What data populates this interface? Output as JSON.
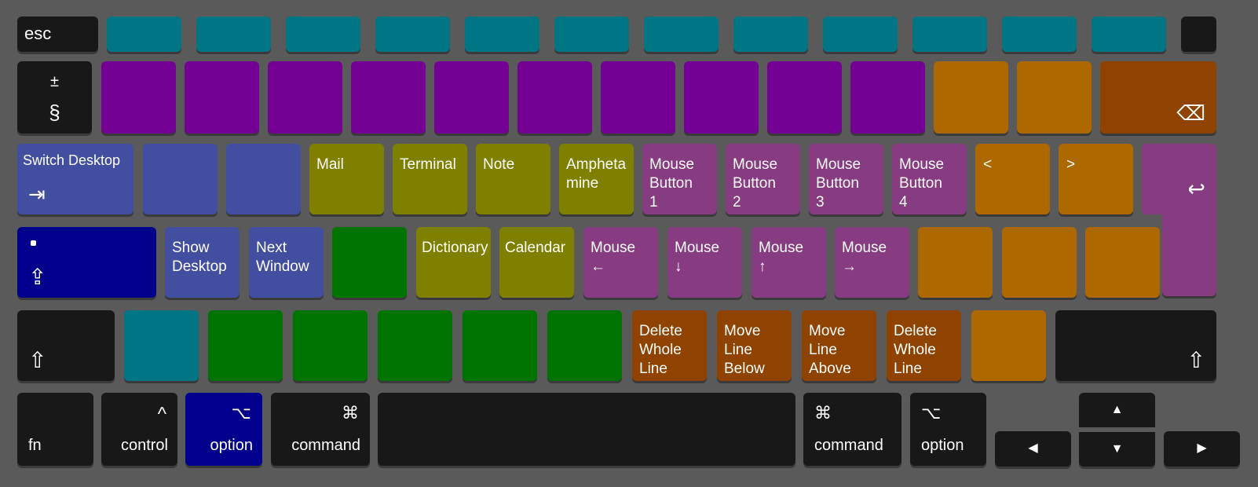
{
  "colors": {
    "background": "#5a5a5a",
    "dark": "#181818",
    "teal": "#007584",
    "purple": "#740094",
    "orange": "#ad6900",
    "dark_orange": "#904200",
    "slate_blue": "#424ea0",
    "olive": "#808000",
    "mauve": "#873b81",
    "navy": "#01008c",
    "green": "#007400"
  },
  "keys": {
    "esc": "esc",
    "plus_minus": "±",
    "section": "§",
    "backspace_icon": "⌫",
    "switch_desktop": "Switch Desktop",
    "tab_icon": "⇥",
    "mail": "Mail",
    "terminal": "Terminal",
    "note": "Note",
    "amphetamine_1": "Ampheta",
    "amphetamine_2": "mine",
    "mouse_button_1_a": "Mouse",
    "mouse_button_1_b": "Button",
    "mouse_button_1_c": "1",
    "mouse_button_2_a": "Mouse",
    "mouse_button_2_b": "Button",
    "mouse_button_2_c": "2",
    "mouse_button_3_a": "Mouse",
    "mouse_button_3_b": "Button",
    "mouse_button_3_c": "3",
    "mouse_button_4_a": "Mouse",
    "mouse_button_4_b": "Button",
    "mouse_button_4_c": "4",
    "less_than": "<",
    "greater_than": ">",
    "return_icon": "↩",
    "caps_icon": "⇪",
    "show_desktop_a": "Show",
    "show_desktop_b": "Desktop",
    "next_window_a": "Next",
    "next_window_b": "Window",
    "dictionary": "Dictionary",
    "calendar": "Calendar",
    "mouse_left_a": "Mouse",
    "mouse_left_b": "←",
    "mouse_down_a": "Mouse",
    "mouse_down_b": "↓",
    "mouse_up_a": "Mouse",
    "mouse_up_b": "↑",
    "mouse_right_a": "Mouse",
    "mouse_right_b": "→",
    "shift_icon": "⇧",
    "delete_whole_line_a": "Delete",
    "delete_whole_line_b": "Whole",
    "delete_whole_line_c": "Line",
    "move_line_below_a": "Move",
    "move_line_below_b": "Line",
    "move_line_below_c": "Below",
    "move_line_above_a": "Move",
    "move_line_above_b": "Line",
    "move_line_above_c": "Above",
    "delete_whole_line2_a": "Delete",
    "delete_whole_line2_b": "Whole",
    "delete_whole_line2_c": "Line",
    "fn": "fn",
    "control_icon": "^",
    "control": "control",
    "option_icon": "⌥",
    "option": "option",
    "command_icon": "⌘",
    "command": "command",
    "arrow_up": "▲",
    "arrow_down": "▼",
    "arrow_left": "◀",
    "arrow_right": "▶"
  }
}
